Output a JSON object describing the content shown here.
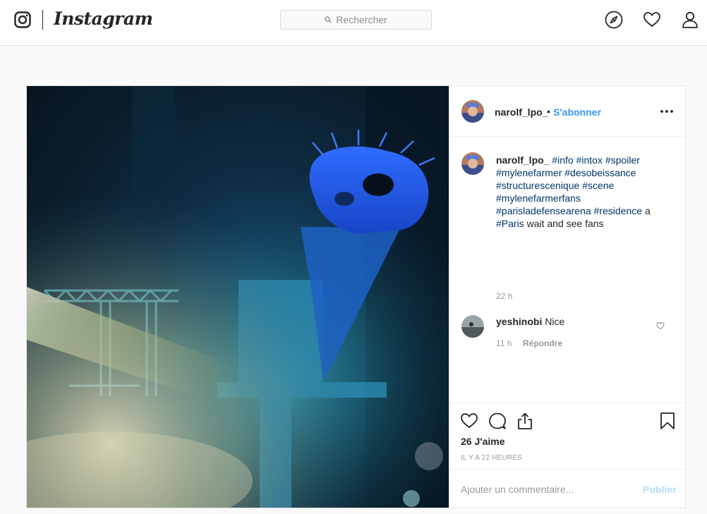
{
  "nav": {
    "wordmark": "Instagram",
    "search_placeholder": "Rechercher"
  },
  "post": {
    "username": "narolf_lpo_",
    "dot": "•",
    "follow_label": "S'abonner",
    "caption": {
      "username": "narolf_lpo_",
      "hashtags_1": [
        "#info",
        "#intox",
        "#spoiler",
        "#mylenefarmer",
        "#desobeissance",
        "#structurescenique",
        "#scene",
        "#mylenefarmerfans",
        "#parisladefensearena",
        "#residence"
      ],
      "word_a": "a",
      "hashtag_paris": "#Paris",
      "tail": "wait and see fans",
      "time": "22 h"
    },
    "comments": [
      {
        "username": "yeshinobi",
        "text": "Nice",
        "time": "11 h",
        "reply_label": "Répondre"
      }
    ],
    "likes": "26 J'aime",
    "time_ago": "IL Y A 22 HEURES",
    "add_comment_placeholder": "Ajouter un commentaire...",
    "publish_label": "Publier"
  },
  "colors": {
    "link_blue": "#3897f0",
    "hashtag": "#003569",
    "publish_disabled": "#b2dffc",
    "muted": "#999999"
  },
  "icons": [
    "instagram-glyph-icon",
    "search-icon",
    "compass-icon",
    "heart-icon",
    "profile-icon",
    "more-icon",
    "like-icon",
    "comment-icon",
    "share-icon",
    "save-icon"
  ]
}
